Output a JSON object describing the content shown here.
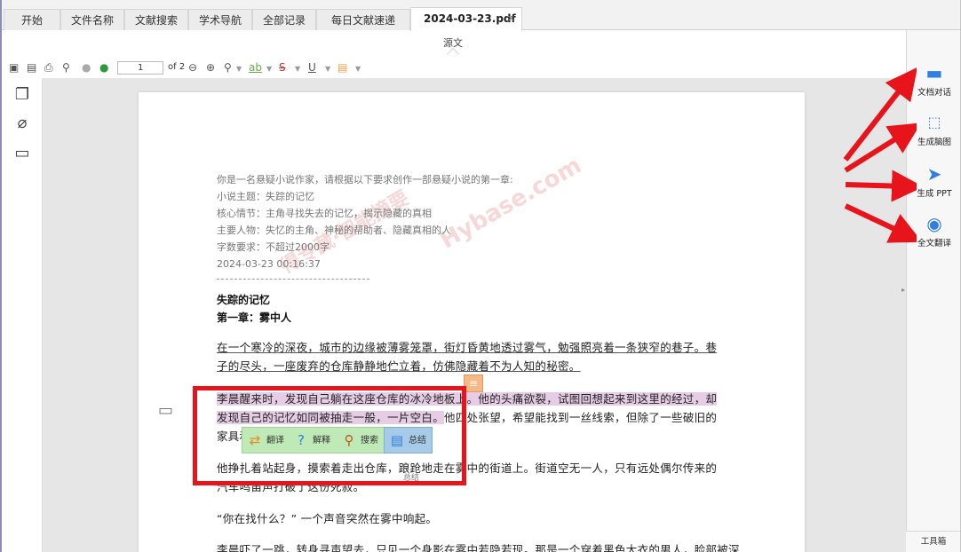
{
  "tabs": [
    {
      "label": "开始"
    },
    {
      "label": "文件名称"
    },
    {
      "label": "文献搜索"
    },
    {
      "label": "学术导航"
    },
    {
      "label": "全部记录"
    },
    {
      "label": "每日文献速递"
    },
    {
      "label": "2024-03-23.pdf",
      "close": "×"
    }
  ],
  "view_label": "源文",
  "toolbar": {
    "page_current": "1",
    "page_total": "of 2",
    "icons": [
      "save-icon",
      "save-as-icon",
      "print-icon",
      "find-icon",
      "prev-page-icon",
      "next-page-icon",
      "zoom-out-icon",
      "zoom-in-icon",
      "zoom-select-icon",
      "highlight-icon",
      "strikethrough-icon",
      "underline-icon",
      "note-icon"
    ]
  },
  "left_sidebar": [
    "pages-icon",
    "attachment-icon",
    "comments-icon"
  ],
  "document": {
    "prompt_lines": [
      "你是一名悬疑小说作家，请根据以下要求创作一部悬疑小说的第一章:",
      "小说主题：失踪的记忆",
      "核心情节：主角寻找失去的记忆，揭示隐藏的真相",
      "主要人物：失忆的主角、神秘的帮助者、隐藏真相的人",
      "字数要求：不超过2000字",
      "2024-03-23 00:16:37"
    ],
    "divider": "--------------------------------------",
    "title": "失踪的记忆",
    "chapter": "第一章：雾中人",
    "p1": "在一个寒冷的深夜，城市的边缘被薄雾笼罩，街灯昏黄地透过雾气，勉强照亮着一条狭窄的巷子。巷子的尽头，一座废弃的仓库静静地伫立着，仿佛隐藏着不为人知的秘密。",
    "p2_highlight": "李晨醒来时，发现自己躺在这座仓库的冰冷地板上。他的头痛欲裂，试图回想起来到这里的经过，却发现自己的记忆如同被抽走一般，一片空白。",
    "p2_rest": "他四处张望，希望能找到一丝线索，但除了一些破旧的家具和几束散落",
    "p3": "他挣扎着站起身，摸索着走出仓库，踉跄地走在雾中的街道上。街道空无一人，只有远处偶尔传来的汽车鸣笛声打破了这份死寂。",
    "p4": "“你在找什么？” 一个声音突然在雾中响起。",
    "p5": "李晨吓了一跳，转身寻声望去，只见一个身影在雾中若隐若现。那是一个穿着黑色大衣的男人，脸部被深"
  },
  "watermark": [
    "得专藏·智能摘要",
    "Hybase.com"
  ],
  "popup": {
    "items": [
      {
        "label": "翻译",
        "icon": "translate-icon"
      },
      {
        "label": "解释",
        "icon": "explain-icon"
      },
      {
        "label": "搜索",
        "icon": "search-icon"
      },
      {
        "label": "总结",
        "icon": "summary-icon"
      }
    ],
    "tooltip": "总结"
  },
  "right_sidebar": {
    "items": [
      {
        "label": "文档对话",
        "icon": "chat-icon"
      },
      {
        "label": "生成脑图",
        "icon": "mindmap-icon"
      },
      {
        "label": "生成 PPT",
        "icon": "ppt-icon"
      },
      {
        "label": "全文翻译",
        "icon": "globe-icon"
      }
    ],
    "footer": "工具箱"
  },
  "colors": {
    "accent": "#2f7ee0",
    "annotation_red": "#e8141b",
    "highlight": "#e6cde5",
    "popup_green": "#bfe9b6"
  }
}
